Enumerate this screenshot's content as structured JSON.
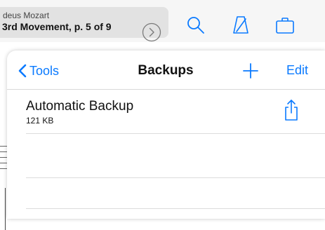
{
  "toolbar": {
    "composer": "deus Mozart",
    "piece_page": "3rd Movement, p. 5 of 9",
    "icons": [
      "chevron-right-circle-icon",
      "search-icon",
      "metronome-icon",
      "briefcase-icon"
    ]
  },
  "popover": {
    "back_label": "Tools",
    "title": "Backups",
    "edit_label": "Edit",
    "items": [
      {
        "name": "Automatic Backup",
        "size": "121 KB",
        "action_icon": "share-icon"
      }
    ]
  },
  "colors": {
    "accent": "#0a7aff",
    "toolbar_bg": "#f6f6f6",
    "title_pill": "#e2e2e2"
  }
}
